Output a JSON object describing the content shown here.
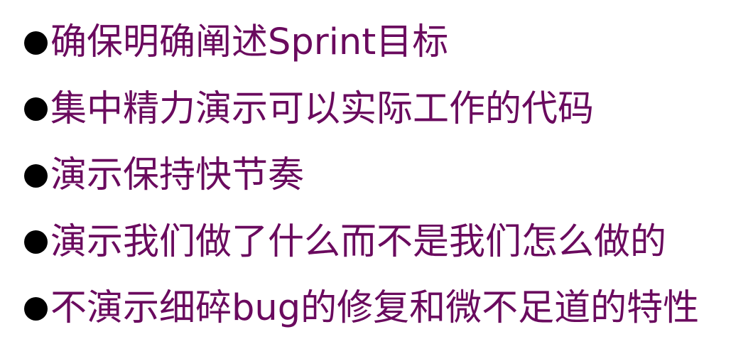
{
  "slide": {
    "text_color": "#6a0a5e",
    "bullet_color": "#000000",
    "bullets": [
      {
        "text": "确保明确阐述Sprint目标"
      },
      {
        "text": "集中精力演示可以实际工作的代码"
      },
      {
        "text": "演示保持快节奏"
      },
      {
        "text": "演示我们做了什么而不是我们怎么做的"
      },
      {
        "text": "不演示细碎bug的修复和微不足道的特性"
      }
    ]
  }
}
